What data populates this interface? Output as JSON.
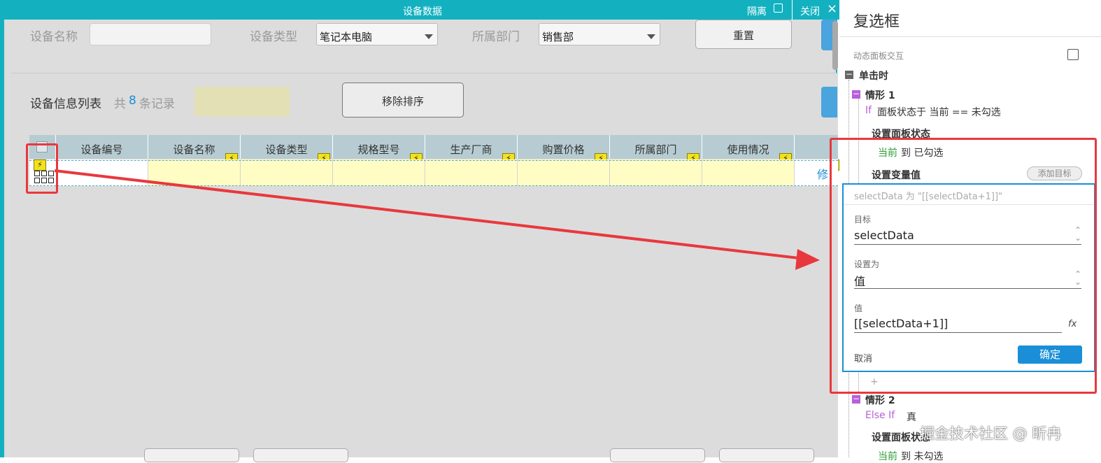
{
  "window": {
    "title": "设备数据",
    "isolate_label": "隔离",
    "close_label": "关闭"
  },
  "filters": {
    "name_label": "设备名称",
    "type_label": "设备类型",
    "type_value": "笔记本电脑",
    "dept_label": "所属部门",
    "dept_value": "销售部",
    "reset_label": "重置"
  },
  "list": {
    "title": "设备信息列表",
    "count_prefix": "共",
    "count": "8",
    "count_suffix": "条记录",
    "remove_sort_label": "移除排序",
    "columns": [
      "设备编号",
      "设备名称",
      "设备类型",
      "规格型号",
      "生产厂商",
      "购置价格",
      "所属部门",
      "使用情况"
    ],
    "edit_link": "修"
  },
  "sidepanel": {
    "title": "复选框",
    "section": "动态面板交互",
    "event": "单击时",
    "case1": {
      "name": "情形 1",
      "cond_kw": "If",
      "cond": "面板状态于 当前 == 未勾选",
      "action1": "设置面板状态",
      "action1_from": "当前",
      "action1_to": "到 已勾选",
      "action2": "设置变量值",
      "add_target": "添加目标"
    },
    "editor": {
      "summary": "selectData 为 \"[[selectData+1]]\"",
      "target_label": "目标",
      "target_value": "selectData",
      "set_label": "设置为",
      "set_value": "值",
      "value_label": "值",
      "value_value": "[[selectData+1]]",
      "fx": "fx",
      "cancel": "取消",
      "ok": "确定"
    },
    "plus": "+",
    "case2": {
      "name": "情形 2",
      "cond_kw": "Else If",
      "cond": "真",
      "action1": "设置面板状态",
      "action1_from": "当前",
      "action1_to": "到 未勾选"
    },
    "watermark": "掘金技术社区 @ 昕冉"
  },
  "colors": {
    "teal": "#13b1c0",
    "red": "#e8383d",
    "blue": "#1a8fd7",
    "header": "#b6ccd2",
    "cell": "#fffdc4"
  }
}
